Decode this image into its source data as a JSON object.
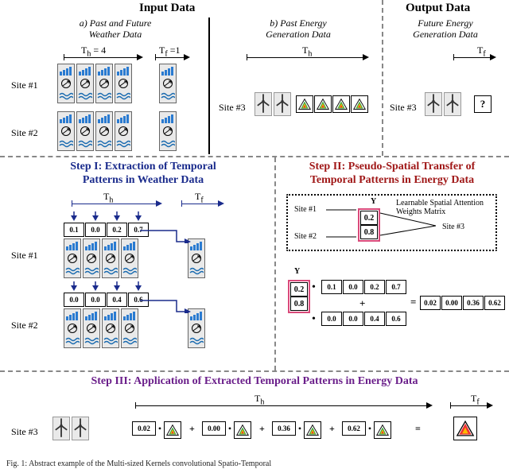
{
  "headers": {
    "input": "Input Data",
    "output": "Output Data",
    "sub_a": "a) Past and Future\nWeather Data",
    "sub_b": "b) Past Energy\nGeneration Data",
    "sub_out": "Future Energy\nGeneration Data"
  },
  "timeline": {
    "th4": "T_h = 4",
    "tf1": "T_f =1",
    "th": "T_h",
    "tf": "T_f"
  },
  "sites": {
    "s1": "Site #1",
    "s2": "Site #2",
    "s3": "Site #3"
  },
  "steps": {
    "s1": "Step I: Extraction of Temporal\nPatterns in Weather Data",
    "s2": "Step II: Pseudo-Spatial Transfer of\nTemporal Patterns in Energy Data",
    "s3": "Step III: Application of Extracted Temporal Patterns in Energy Data"
  },
  "step1": {
    "row1": [
      "0.1",
      "0.0",
      "0.2",
      "0.7"
    ],
    "row2": [
      "0.0",
      "0.0",
      "0.4",
      "0.6"
    ]
  },
  "step2": {
    "matrix_note": "Learnable Spatial Attention\nWeights Matrix",
    "y": "Y",
    "yvals": [
      "0.2",
      "0.8"
    ],
    "eq_left_a": [
      "0.1",
      "0.0",
      "0.2",
      "0.7"
    ],
    "eq_left_b": [
      "0.0",
      "0.0",
      "0.4",
      "0.6"
    ],
    "eq_right": [
      "0.02",
      "0.00",
      "0.36",
      "0.62"
    ],
    "plus": "+",
    "eq": "=",
    "dot": "•"
  },
  "step3": {
    "weights": [
      "0.02",
      "0.00",
      "0.36",
      "0.62"
    ],
    "plus": "+",
    "eq": "=",
    "dot": "•"
  },
  "output": {
    "q": "?"
  },
  "caption": "Fig. 1: Abstract example of the Multi-sized Kernels convolutional Spatio-Temporal",
  "chart_data": {
    "type": "table",
    "title": "Temporal pattern weights and spatial attention example",
    "temporal_weights": {
      "site1": [
        0.1,
        0.0,
        0.2,
        0.7
      ],
      "site2": [
        0.0,
        0.0,
        0.4,
        0.6
      ]
    },
    "spatial_attention_Y": {
      "site1": 0.2,
      "site2": 0.8
    },
    "combined_result": [
      0.02,
      0.0,
      0.36,
      0.62
    ],
    "T_h": 4,
    "T_f": 1
  }
}
